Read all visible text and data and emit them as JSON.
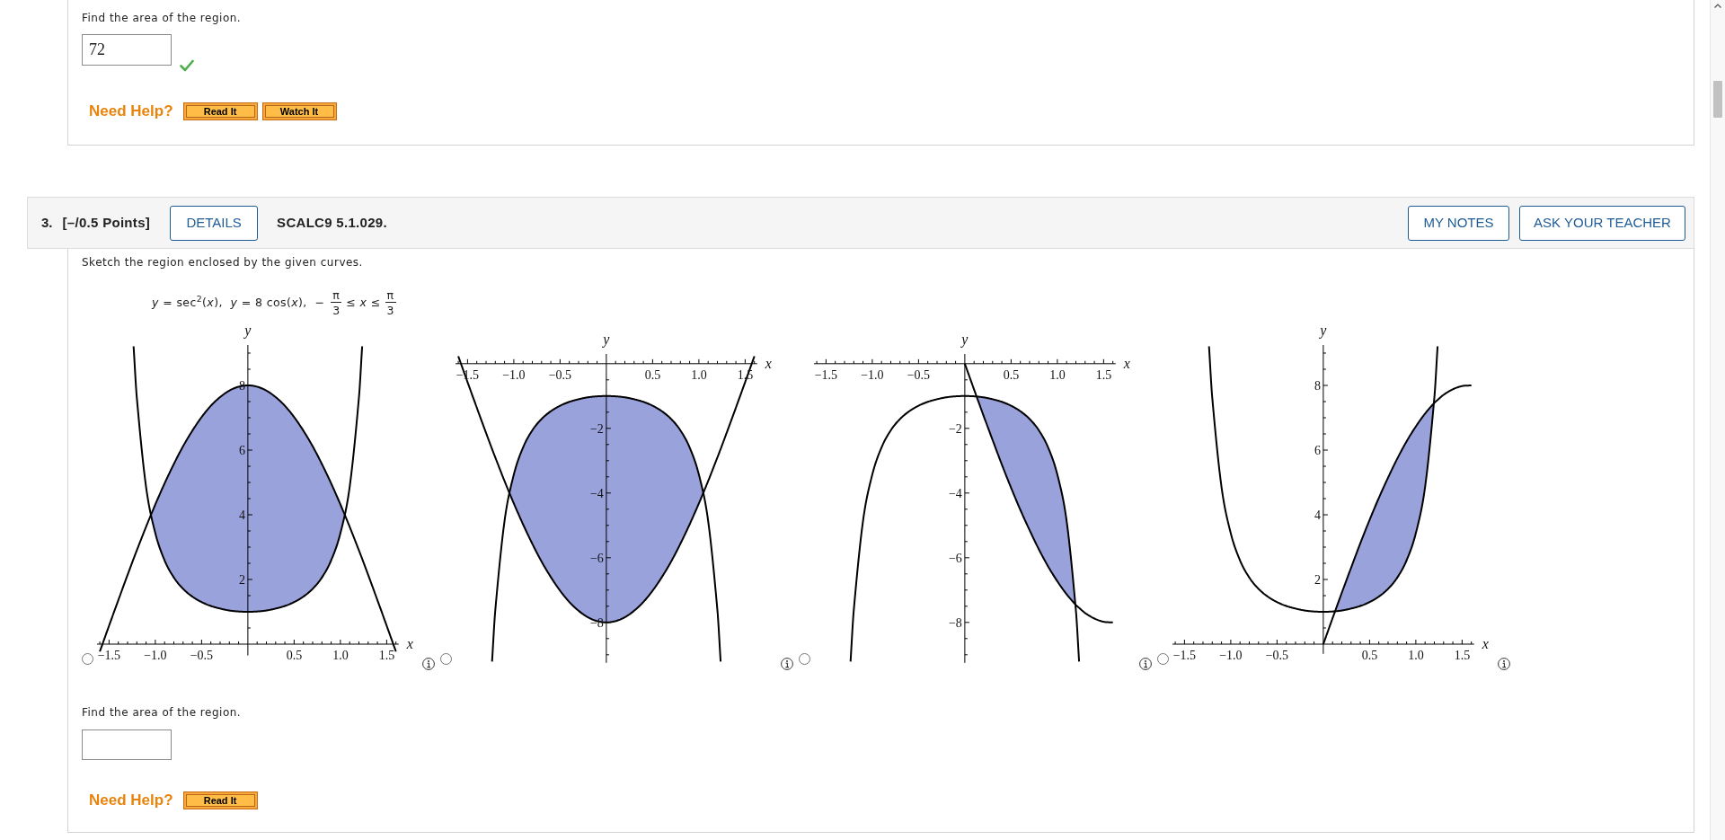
{
  "previous_question": {
    "prompt": "Find the area of the region.",
    "answer": {
      "value": "72",
      "correct": true
    },
    "help": {
      "label": "Need Help?",
      "buttons": [
        "Read It",
        "Watch It"
      ]
    }
  },
  "question": {
    "number": "3.",
    "points": "[–/0.5 Points]",
    "details_button": "DETAILS",
    "code": "SCALC9 5.1.029.",
    "actions": [
      "MY NOTES",
      "ASK YOUR TEACHER"
    ],
    "instruction": "Sketch the region enclosed by the given curves.",
    "equation": {
      "lead": "*y* = sec$^{2}$(*x*),  *y* = 8 cos(*x*),  −",
      "lower_bound": {
        "numerator": "π",
        "denominator": "3"
      },
      "middle": "≤ *x* ≤",
      "upper_bound": {
        "numerator": "π",
        "denominator": "3"
      }
    },
    "options": [
      {
        "selected": false,
        "chart_data": {
          "type": "line",
          "xlabel": "x",
          "ylabel": "y",
          "x": [
            -1.6,
            -1.5,
            -1.4,
            -1.3,
            -1.235,
            -1.2,
            -1.1,
            -1.0,
            -0.9,
            -0.8,
            -0.7,
            -0.6,
            -0.5,
            -0.4,
            -0.3,
            -0.2,
            -0.1,
            0,
            0.1,
            0.2,
            0.3,
            0.4,
            0.5,
            0.6,
            0.7,
            0.8,
            0.9,
            1.0,
            1.1,
            1.2,
            1.235,
            1.3,
            1.4,
            1.5,
            1.6
          ],
          "series": [
            {
              "color": "#000000",
              "values": [
                null,
                null,
                null,
                null,
                9.21,
                7.62,
                4.86,
                3.43,
                2.59,
                2.06,
                1.71,
                1.47,
                1.3,
                1.18,
                1.1,
                1.04,
                1.01,
                1,
                1.01,
                1.04,
                1.1,
                1.18,
                1.3,
                1.47,
                1.71,
                2.06,
                2.59,
                3.43,
                4.86,
                7.62,
                9.21,
                null,
                null,
                null,
                null
              ]
            },
            {
              "color": "#000000",
              "values": [
                -0.23,
                0.57,
                1.36,
                2.14,
                2.64,
                2.9,
                3.63,
                4.32,
                4.97,
                5.57,
                6.12,
                6.6,
                7.02,
                7.37,
                7.64,
                7.84,
                7.96,
                8,
                7.96,
                7.84,
                7.64,
                7.37,
                7.02,
                6.6,
                6.12,
                5.57,
                4.97,
                4.32,
                3.63,
                2.9,
                2.64,
                2.14,
                1.36,
                0.57,
                -0.23
              ]
            }
          ],
          "xlim": [
            -1.63,
            1.63
          ],
          "ylim": [
            -0.35,
            9.25
          ],
          "xticks": [
            {
              "value": -1.5,
              "label": "−1.5"
            },
            {
              "value": -1.0,
              "label": "−1.0"
            },
            {
              "value": -0.5,
              "label": "−0.5"
            },
            {
              "value": 0.5,
              "label": "0.5"
            },
            {
              "value": 1.0,
              "label": "1.0"
            },
            {
              "value": 1.5,
              "label": "1.5"
            }
          ],
          "yticks": [
            {
              "value": 2,
              "label": "2"
            },
            {
              "value": 4,
              "label": "4"
            },
            {
              "value": 6,
              "label": "6"
            },
            {
              "value": 8,
              "label": "8"
            }
          ]
        }
      },
      {
        "selected": false,
        "chart_data": {
          "type": "line",
          "xlabel": "x",
          "ylabel": "y",
          "x": [
            -1.6,
            -1.5,
            -1.4,
            -1.3,
            -1.235,
            -1.2,
            -1.1,
            -1.0,
            -0.9,
            -0.8,
            -0.7,
            -0.6,
            -0.5,
            -0.4,
            -0.3,
            -0.2,
            -0.1,
            0,
            0.1,
            0.2,
            0.3,
            0.4,
            0.5,
            0.6,
            0.7,
            0.8,
            0.9,
            1.0,
            1.1,
            1.2,
            1.235,
            1.3,
            1.4,
            1.5,
            1.6
          ],
          "series": [
            {
              "color": "#000000",
              "values": [
                null,
                null,
                null,
                null,
                -9.21,
                -7.62,
                -4.86,
                -3.43,
                -2.59,
                -2.06,
                -1.71,
                -1.47,
                -1.3,
                -1.18,
                -1.1,
                -1.04,
                -1.01,
                -1,
                -1.01,
                -1.04,
                -1.1,
                -1.18,
                -1.3,
                -1.47,
                -1.71,
                -2.06,
                -2.59,
                -3.43,
                -4.86,
                -7.62,
                -9.21,
                null,
                null,
                null,
                null
              ]
            },
            {
              "color": "#000000",
              "values": [
                0.23,
                -0.57,
                -1.36,
                -2.14,
                -2.64,
                -2.9,
                -3.63,
                -4.32,
                -4.97,
                -5.57,
                -6.12,
                -6.6,
                -7.02,
                -7.37,
                -7.64,
                -7.84,
                -7.96,
                -8,
                -7.96,
                -7.84,
                -7.64,
                -7.37,
                -7.02,
                -6.6,
                -6.12,
                -5.57,
                -4.97,
                -4.32,
                -3.63,
                -2.9,
                -2.64,
                -2.14,
                -1.36,
                -0.57,
                0.23
              ]
            }
          ],
          "xlim": [
            -1.63,
            1.63
          ],
          "ylim": [
            -9.25,
            0.3
          ],
          "xticks": [
            {
              "value": -1.5,
              "label": "−1.5"
            },
            {
              "value": -1.0,
              "label": "−1.0"
            },
            {
              "value": -0.5,
              "label": "−0.5"
            },
            {
              "value": 0.5,
              "label": "0.5"
            },
            {
              "value": 1.0,
              "label": "1.0"
            },
            {
              "value": 1.5,
              "label": "1.5"
            }
          ],
          "yticks": [
            {
              "value": -2,
              "label": "−2"
            },
            {
              "value": -4,
              "label": "−4"
            },
            {
              "value": -6,
              "label": "−6"
            },
            {
              "value": -8,
              "label": "−8"
            }
          ]
        }
      },
      {
        "selected": false,
        "chart_data": {
          "type": "line",
          "xlabel": "x",
          "ylabel": "y",
          "x": [
            -1.235,
            -1.2,
            -1.1,
            -1.0,
            -0.9,
            -0.8,
            -0.7,
            -0.6,
            -0.5,
            -0.4,
            -0.3,
            -0.2,
            -0.1,
            0,
            0.1,
            0.2,
            0.3,
            0.4,
            0.5,
            0.6,
            0.7,
            0.8,
            0.9,
            1.0,
            1.1,
            1.2,
            1.235,
            1.3,
            1.4,
            1.5,
            1.6
          ],
          "series": [
            {
              "color": "#000000",
              "values": [
                -9.21,
                -7.62,
                -4.86,
                -3.43,
                -2.59,
                -2.06,
                -1.71,
                -1.47,
                -1.3,
                -1.18,
                -1.1,
                -1.04,
                -1.01,
                -1,
                -1.01,
                -1.04,
                -1.1,
                -1.18,
                -1.3,
                -1.47,
                -1.71,
                -2.06,
                -2.59,
                -3.43,
                -4.86,
                -7.62,
                -9.21,
                null,
                null,
                null,
                null
              ]
            },
            {
              "color": "#000000",
              "values": [
                null,
                null,
                null,
                null,
                null,
                null,
                null,
                null,
                null,
                null,
                null,
                null,
                null,
                0,
                -0.8,
                -1.59,
                -2.36,
                -3.12,
                -3.84,
                -4.52,
                -5.15,
                -5.74,
                -6.27,
                -6.73,
                -7.13,
                -7.46,
                -7.55,
                -7.71,
                -7.88,
                -7.98,
                -8
              ]
            }
          ],
          "xlim": [
            -1.63,
            1.63
          ],
          "ylim": [
            -9.25,
            0.3
          ],
          "xticks": [
            {
              "value": -1.5,
              "label": "−1.5"
            },
            {
              "value": -1.0,
              "label": "−1.0"
            },
            {
              "value": -0.5,
              "label": "−0.5"
            },
            {
              "value": 0.5,
              "label": "0.5"
            },
            {
              "value": 1.0,
              "label": "1.0"
            },
            {
              "value": 1.5,
              "label": "1.5"
            }
          ],
          "yticks": [
            {
              "value": -2,
              "label": "−2"
            },
            {
              "value": -4,
              "label": "−4"
            },
            {
              "value": -6,
              "label": "−6"
            },
            {
              "value": -8,
              "label": "−8"
            }
          ]
        }
      },
      {
        "selected": false,
        "chart_data": {
          "type": "line",
          "xlabel": "x",
          "ylabel": "y",
          "x": [
            -1.235,
            -1.2,
            -1.1,
            -1.0,
            -0.9,
            -0.8,
            -0.7,
            -0.6,
            -0.5,
            -0.4,
            -0.3,
            -0.2,
            -0.1,
            0,
            0.1,
            0.2,
            0.3,
            0.4,
            0.5,
            0.6,
            0.7,
            0.8,
            0.9,
            1.0,
            1.1,
            1.2,
            1.235,
            1.3,
            1.4,
            1.5,
            1.6
          ],
          "series": [
            {
              "color": "#000000",
              "values": [
                9.21,
                7.62,
                4.86,
                3.43,
                2.59,
                2.06,
                1.71,
                1.47,
                1.3,
                1.18,
                1.1,
                1.04,
                1.01,
                1,
                1.01,
                1.04,
                1.1,
                1.18,
                1.3,
                1.47,
                1.71,
                2.06,
                2.59,
                3.43,
                4.86,
                7.62,
                9.21,
                null,
                null,
                null,
                null
              ]
            },
            {
              "color": "#000000",
              "values": [
                null,
                null,
                null,
                null,
                null,
                null,
                null,
                null,
                null,
                null,
                null,
                null,
                null,
                0,
                0.8,
                1.59,
                2.36,
                3.12,
                3.84,
                4.52,
                5.15,
                5.74,
                6.27,
                6.73,
                7.13,
                7.46,
                7.55,
                7.71,
                7.88,
                7.98,
                8
              ]
            }
          ],
          "xlim": [
            -1.63,
            1.63
          ],
          "ylim": [
            -0.3,
            9.25
          ],
          "xticks": [
            {
              "value": -1.5,
              "label": "−1.5"
            },
            {
              "value": -1.0,
              "label": "−1.0"
            },
            {
              "value": -0.5,
              "label": "−0.5"
            },
            {
              "value": 0.5,
              "label": "0.5"
            },
            {
              "value": 1.0,
              "label": "1.0"
            },
            {
              "value": 1.5,
              "label": "1.5"
            }
          ],
          "yticks": [
            {
              "value": 2,
              "label": "2"
            },
            {
              "value": 4,
              "label": "4"
            },
            {
              "value": 6,
              "label": "6"
            },
            {
              "value": 8,
              "label": "8"
            }
          ]
        }
      }
    ],
    "area_prompt": "Find the area of the region.",
    "help": {
      "label": "Need Help?",
      "buttons": [
        "Read It"
      ]
    }
  }
}
